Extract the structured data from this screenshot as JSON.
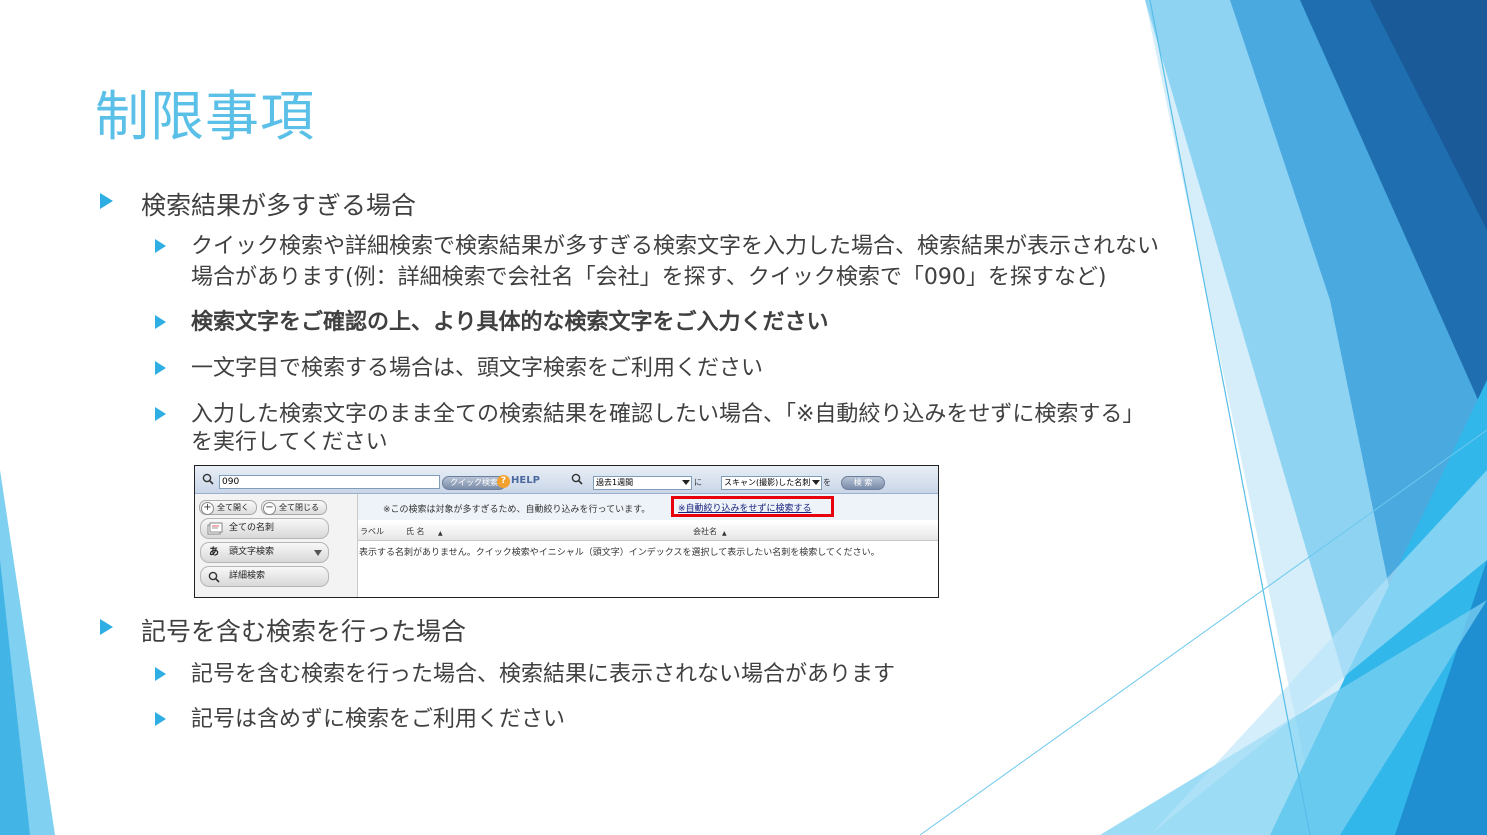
{
  "title": "制限事項",
  "sections": [
    {
      "heading": "検索結果が多すぎる場合",
      "items": [
        {
          "line1": "クイック検索や詳細検索で検索結果が多すぎる検索文字を入力した場合、検索結果が表示されない",
          "line2": "場合があります(例：詳細検索で会社名「会社」を探す、クイック検索で「090」を探すなど)"
        },
        {
          "line1": "検索文字をご確認の上、より具体的な検索文字をご入力ください",
          "bold": true
        },
        {
          "line1": "一文字目で検索する場合は、頭文字検索をご利用ください"
        },
        {
          "line1": "入力した検索文字のまま全ての検索結果を確認したい場合、「※自動絞り込みをせずに検索する」",
          "line2": "を実行してください"
        }
      ]
    },
    {
      "heading": "記号を含む検索を行った場合",
      "items": [
        {
          "line1": "記号を含む検索を行った場合、検索結果に表示されない場合があります"
        },
        {
          "line1": "記号は含めずに検索をご利用ください"
        }
      ]
    }
  ],
  "screenshot": {
    "search_value": "090",
    "quick_search_label": "クイック検索",
    "help_icon": "?",
    "help_label": "HELP",
    "period_select": "過去1週間",
    "ni_label": "に",
    "target_select": "スキャン(撮影)した名刺",
    "wo_label": "を",
    "search_button": "検 索",
    "expand_all": "全て開く",
    "collapse_all": "全て閉じる",
    "expand_icon": "+",
    "collapse_icon": "−",
    "all_cards": "全ての名刺",
    "initial_icon": "あ",
    "initial_search": "頭文字検索",
    "detail_search": "詳細検索",
    "message": "※この検索は対象が多すぎるため、自動絞り込みを行っています。",
    "no_filter_link": "※自動絞り込みをせずに検索する",
    "col_label": "ラベル",
    "col_name": "氏 名",
    "col_company": "会社名",
    "empty_message": "表示する名刺がありません。クイック検索やイニシャル（頭文字）インデックスを選択して表示したい名刺を検索してください。"
  },
  "colors": {
    "title": "#5bc0e8",
    "bullet": "#2eaee3",
    "highlight_box": "#e8000d"
  }
}
